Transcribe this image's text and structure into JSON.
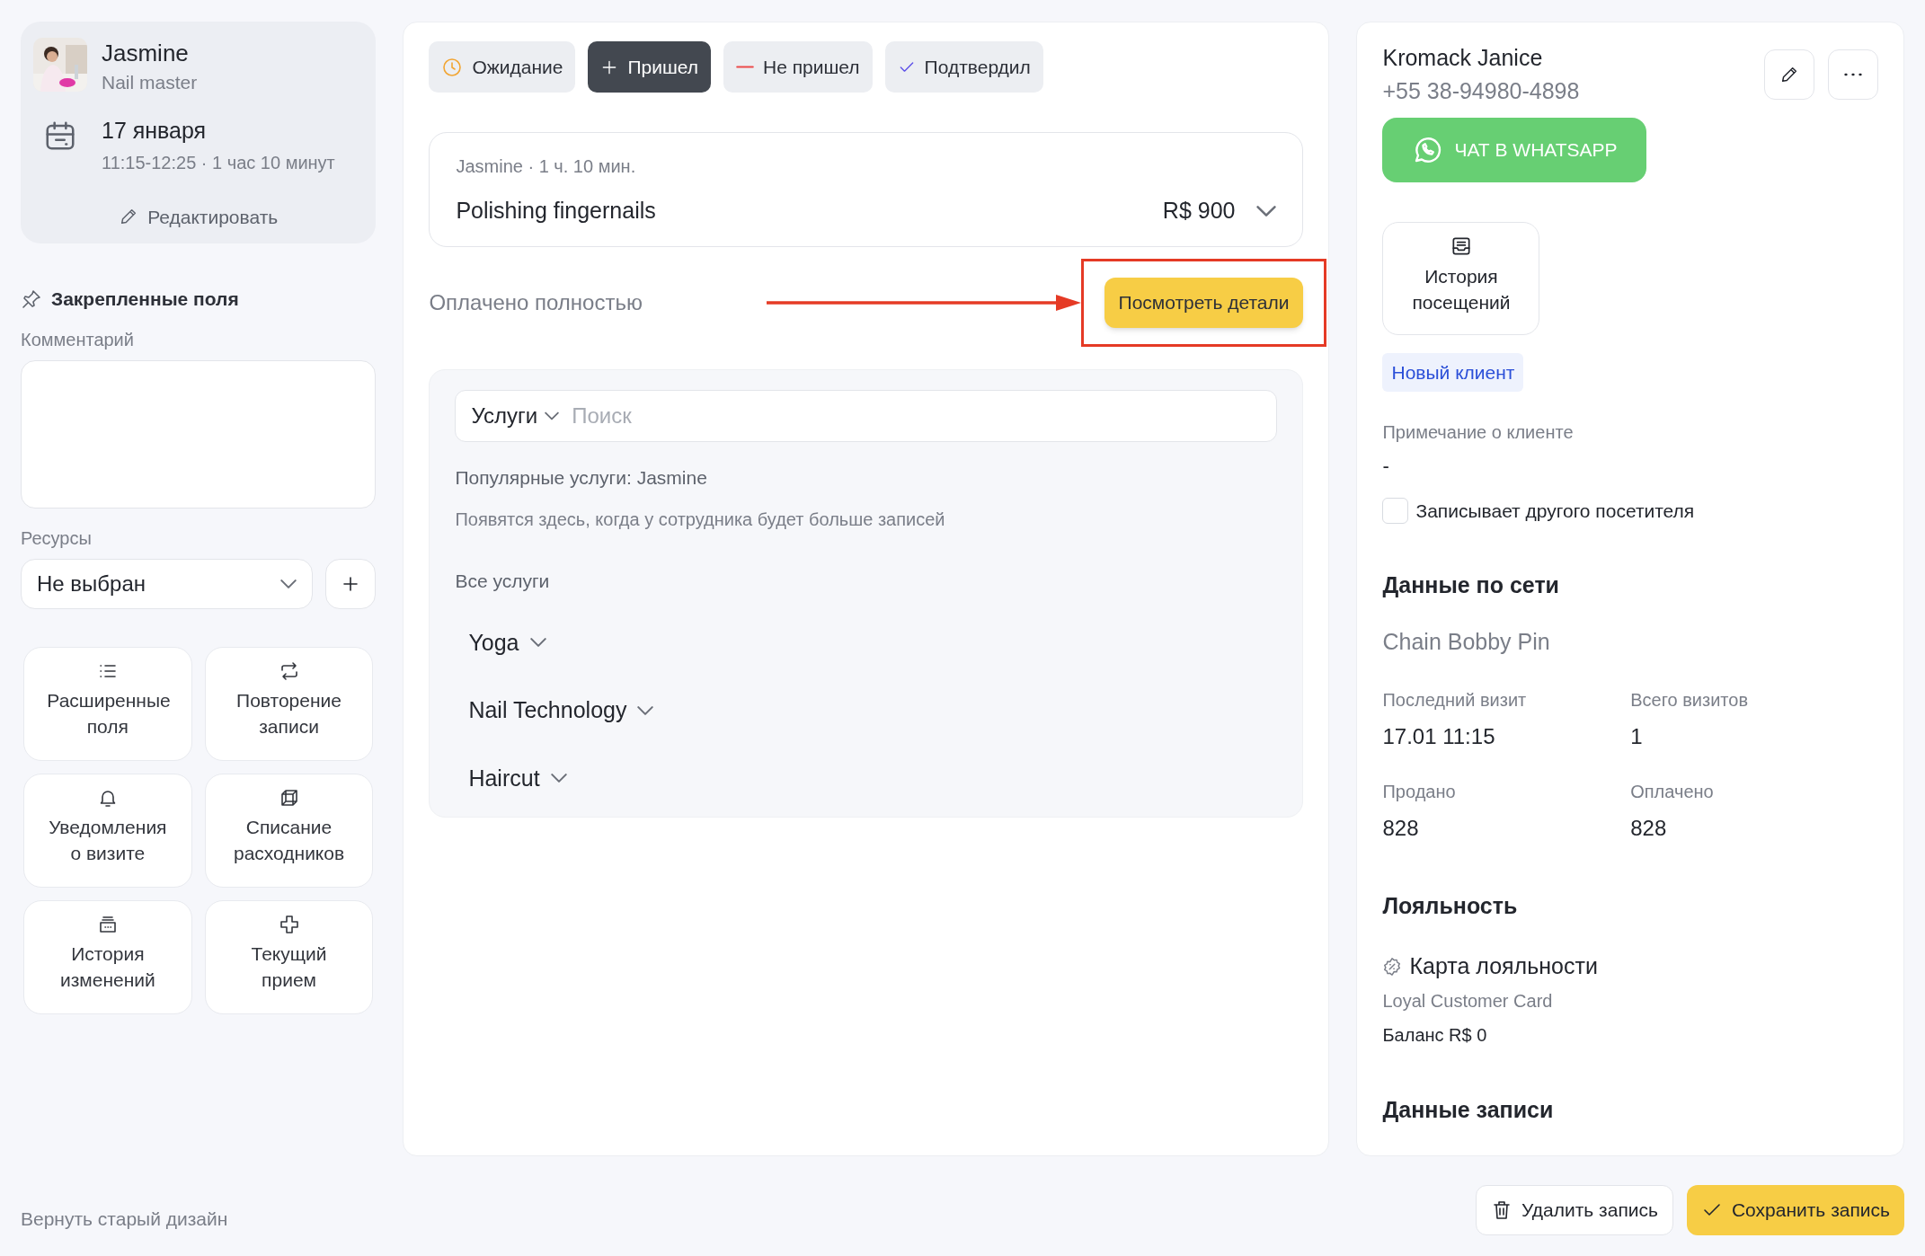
{
  "staff_card": {
    "name": "Jasmine",
    "role": "Nail master",
    "date": "17 января",
    "time": "11:15-12:25 · 1 час 10 минут",
    "edit_link": "Редактировать"
  },
  "pinned_fields": {
    "title": "Закрепленные поля",
    "comment_label": "Комментарий",
    "resources_label": "Ресурсы",
    "resources_value": "Не выбран"
  },
  "action_tiles": [
    {
      "kind": "list",
      "label": "Расширенные поля"
    },
    {
      "kind": "repeat",
      "label": "Повторение записи"
    },
    {
      "kind": "bell",
      "label": "Уведомления о визите"
    },
    {
      "kind": "cube",
      "label": "Списание расходников"
    },
    {
      "kind": "stack",
      "label": "История изменений"
    },
    {
      "kind": "cross",
      "label": "Текущий прием"
    }
  ],
  "old_design_link": "Вернуть старый дизайн",
  "status_tabs": [
    {
      "kind": "waiting",
      "label": "Ожидание",
      "selected": false
    },
    {
      "kind": "arrived",
      "label": "Пришел",
      "selected": true
    },
    {
      "kind": "no_show",
      "label": "Не пришел",
      "selected": false
    },
    {
      "kind": "confirmed",
      "label": "Подтвердил",
      "selected": false
    }
  ],
  "service_line": {
    "meta": "Jasmine · 1 ч. 10 мин.",
    "name": "Polishing fingernails",
    "price": "R$ 900"
  },
  "payment": {
    "status": "Оплачено полностью",
    "details_button": "Посмотреть детали",
    "highlighted": true
  },
  "services_picker": {
    "category": "Услуги",
    "search_placeholder": "Поиск",
    "popular_title": "Популярные услуги: Jasmine",
    "popular_hint": "Появятся здесь, когда у сотрудника будет больше записей",
    "all_title": "Все услуги",
    "categories": [
      {
        "name": "Yoga",
        "expanded": false
      },
      {
        "name": "Nail Technology",
        "expanded": false
      },
      {
        "name": "Haircut",
        "expanded": false
      }
    ]
  },
  "client": {
    "name": "Kromack Janice",
    "phone": "+55 38-94980-4898",
    "whatsapp_button": "ЧАТ В WHATSAPP",
    "history_tile": "История посещений",
    "badge": "Новый клиент",
    "note_label": "Примечание о клиенте",
    "note_value": "-",
    "other_visitor": {
      "label": "Записывает другого посетителя",
      "checked": false
    }
  },
  "network": {
    "title": "Данные по сети",
    "chain": "Chain Bobby Pin",
    "stats": [
      {
        "label": "Последний визит",
        "value": "17.01 11:15"
      },
      {
        "label": "Всего визитов",
        "value": "1"
      },
      {
        "label": "Продано",
        "value": "828"
      },
      {
        "label": "Оплачено",
        "value": "828"
      }
    ]
  },
  "loyalty": {
    "title": "Лояльность",
    "card_title": "Карта лояльности",
    "card_name": "Loyal Customer Card",
    "balance": "Баланс R$ 0"
  },
  "record_data": {
    "title": "Данные записи"
  },
  "footer_buttons": {
    "delete": "Удалить запись",
    "save": "Сохранить запись"
  }
}
